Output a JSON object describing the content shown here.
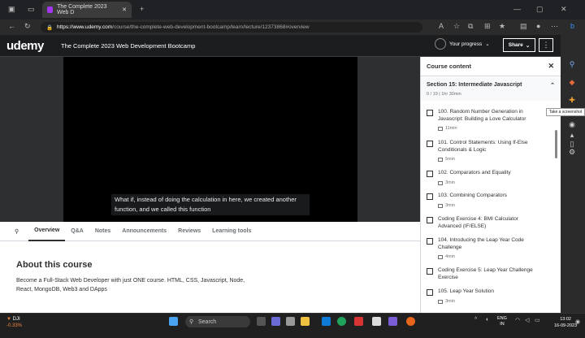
{
  "browser": {
    "tab_title": "The Complete 2023 Web D",
    "url_host": "https://www.udemy.com",
    "url_path": "/course/the-complete-web-development-bootcamp/learn/lecture/12373868#overview",
    "colors": {
      "tabbar": "#202124",
      "brand": "#a435f0"
    }
  },
  "header": {
    "logo": "udemy",
    "course_title": "The Complete 2023 Web Development Bootcamp",
    "progress_label": "Your progress",
    "share_label": "Share",
    "more_icon": "⋮"
  },
  "player": {
    "caption": "What if, instead of doing the calculation in here, we created another function, and we called this function"
  },
  "tabs": [
    {
      "label": "Overview"
    },
    {
      "label": "Q&A"
    },
    {
      "label": "Notes"
    },
    {
      "label": "Announcements"
    },
    {
      "label": "Reviews"
    },
    {
      "label": "Learning tools"
    }
  ],
  "overview": {
    "heading": "About this course",
    "description": "Become a Full-Stack Web Developer with just ONE course. HTML, CSS, Javascript, Node, React, MongoDB, Web3 and DApps"
  },
  "sidebar": {
    "title": "Course content",
    "section_title": "Section 15: Intermediate Javascript",
    "section_meta": "0 / 19 | 1hr 30min",
    "lessons": [
      {
        "title": "100. Random Number Generation in Javascript: Building a Love Calculator",
        "duration": "11min"
      },
      {
        "title": "101. Control Statements: Using If-Else Conditionals & Logic",
        "duration": "5min"
      },
      {
        "title": "102. Comparators and Equality",
        "duration": "3min"
      },
      {
        "title": "103. Combining Comparators",
        "duration": "3min"
      },
      {
        "title": "Coding Exercise 4: BMI Calculator Advanced (IF/ELSE)",
        "duration": ""
      },
      {
        "title": "104. Introducing the Leap Year Code Challenge",
        "duration": "4min"
      },
      {
        "title": "Coding Exercise 5: Leap Year Challenge Exercise",
        "duration": ""
      },
      {
        "title": "105. Leap Year Solution",
        "duration": "3min"
      }
    ]
  },
  "tooltip": "Take a screenshot",
  "taskbar": {
    "weather_label": "DJI",
    "weather_value": "-0.33%",
    "search_placeholder": "Search",
    "tray_lang": "ENG",
    "tray_region": "IN",
    "time": "13:02",
    "date": "16-09-2023"
  }
}
